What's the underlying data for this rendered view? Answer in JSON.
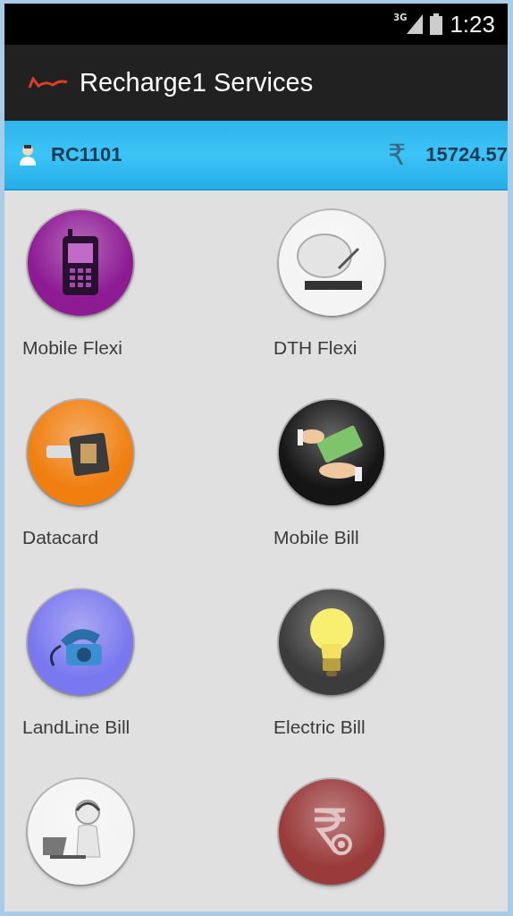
{
  "status_bar": {
    "time": "1:23",
    "network": "3G"
  },
  "action_bar": {
    "title": "Recharge1 Services"
  },
  "account_bar": {
    "user_id": "RC1101",
    "currency": "₹",
    "balance": "15724.57"
  },
  "services": [
    {
      "kind": "phone",
      "color": "#8e1a94",
      "label": "Mobile Flexi"
    },
    {
      "kind": "dish",
      "color": "#f4f4f4",
      "label": "DTH Flexi"
    },
    {
      "kind": "datacard",
      "color": "#f07f10",
      "label": "Datacard"
    },
    {
      "kind": "cash",
      "color": "#151515",
      "label": "Mobile Bill"
    },
    {
      "kind": "telephone",
      "color": "#7a78ee",
      "label": "LandLine Bill"
    },
    {
      "kind": "bulb",
      "color": "#3c3c3c",
      "label": "Electric Bill"
    },
    {
      "kind": "support",
      "color": "#f4f4f4"
    },
    {
      "kind": "rupee",
      "color": "#9a3a3a"
    }
  ]
}
